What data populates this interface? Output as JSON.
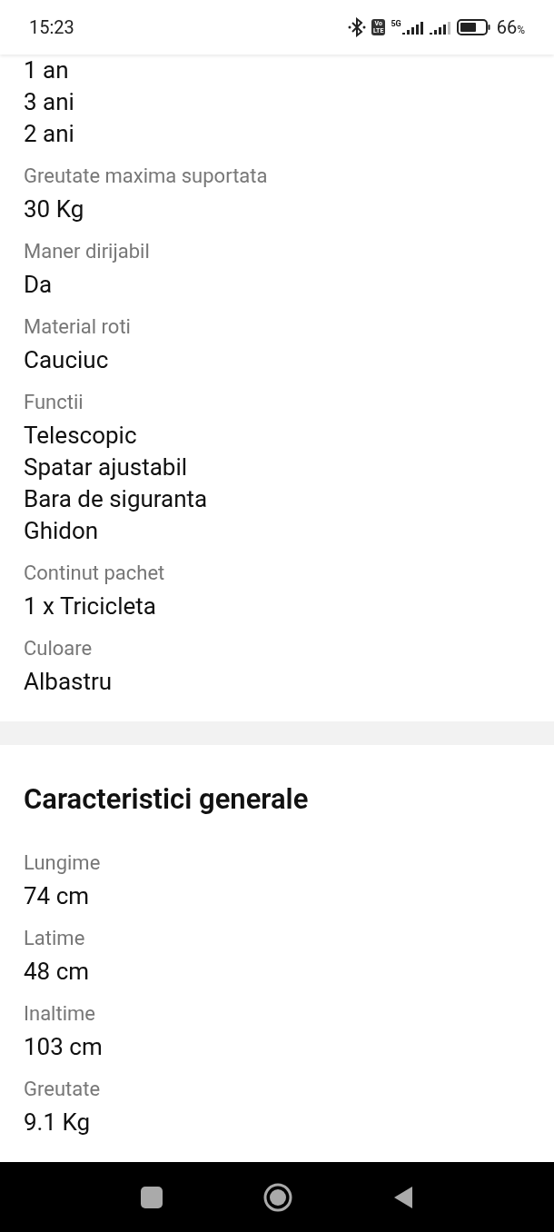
{
  "status_bar": {
    "time": "15:23",
    "volte": [
      "Vo",
      "LTE"
    ],
    "network": "5G",
    "battery": "66",
    "battery_unit": "%"
  },
  "sections": [
    {
      "specs": [
        {
          "values": [
            "1 an",
            "3 ani",
            "2 ani"
          ]
        },
        {
          "label": "Greutate maxima suportata",
          "values": [
            "30 Kg"
          ]
        },
        {
          "label": "Maner dirijabil",
          "values": [
            "Da"
          ]
        },
        {
          "label": "Material roti",
          "values": [
            "Cauciuc"
          ]
        },
        {
          "label": "Functii",
          "values": [
            "Telescopic",
            "Spatar ajustabil",
            "Bara de siguranta",
            "Ghidon"
          ]
        },
        {
          "label": "Continut pachet",
          "values": [
            "1 x Tricicleta"
          ]
        },
        {
          "label": "Culoare",
          "values": [
            "Albastru"
          ]
        }
      ]
    },
    {
      "title": "Caracteristici generale",
      "specs": [
        {
          "label": "Lungime",
          "values": [
            "74 cm"
          ]
        },
        {
          "label": "Latime",
          "values": [
            "48 cm"
          ]
        },
        {
          "label": "Inaltime",
          "values": [
            "103 cm"
          ]
        },
        {
          "label": "Greutate",
          "values": [
            "9.1 Kg"
          ]
        }
      ]
    }
  ]
}
